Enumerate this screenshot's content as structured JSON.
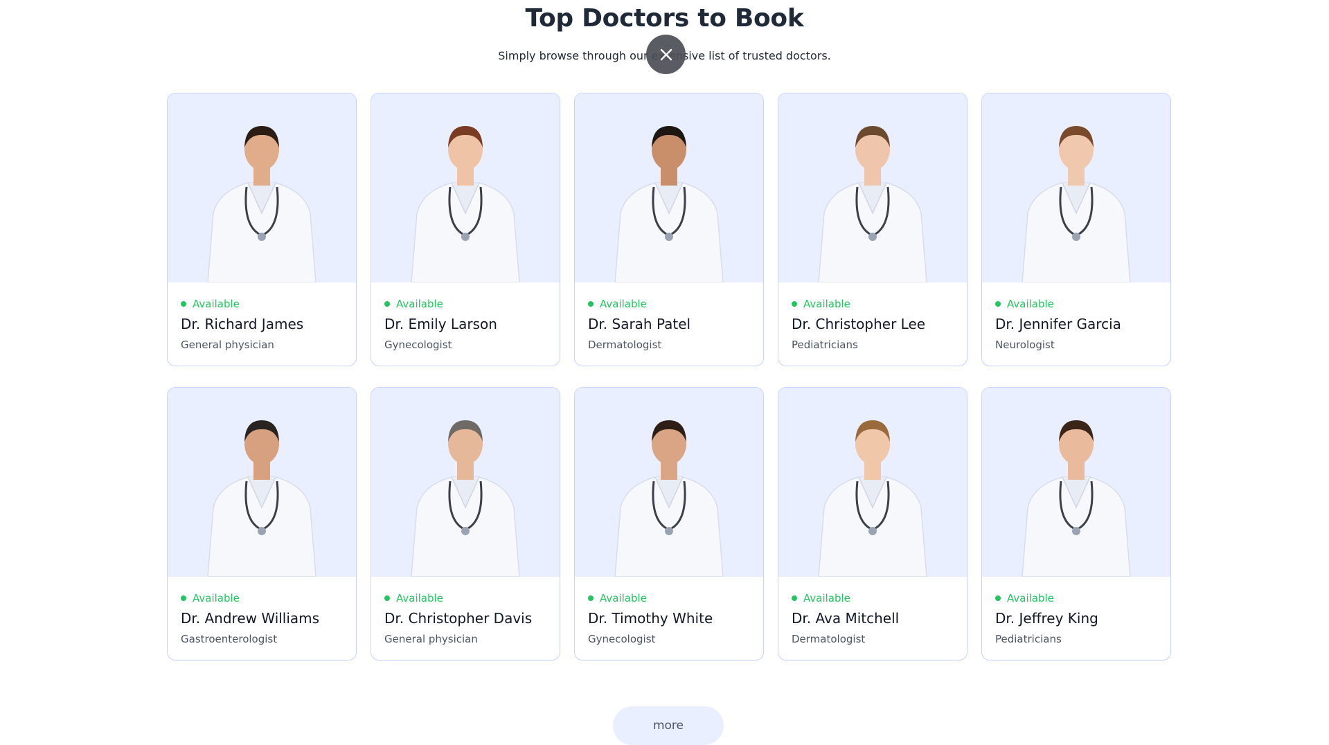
{
  "header": {
    "title": "Top Doctors to Book",
    "subtitle": "Simply browse through our extensive list of trusted doctors."
  },
  "overlay": {
    "close_icon": "close-icon"
  },
  "doctors": [
    {
      "status": "Available",
      "name": "Dr. Richard James",
      "specialty": "General physician",
      "skin": "#e0ac8a",
      "hair": "#2b1d14"
    },
    {
      "status": "Available",
      "name": "Dr. Emily Larson",
      "specialty": "Gynecologist",
      "skin": "#efc3a6",
      "hair": "#7a3b22"
    },
    {
      "status": "Available",
      "name": "Dr. Sarah Patel",
      "specialty": "Dermatologist",
      "skin": "#c98f6b",
      "hair": "#1e1712"
    },
    {
      "status": "Available",
      "name": "Dr. Christopher Lee",
      "specialty": "Pediatricians",
      "skin": "#efc6ac",
      "hair": "#6b4a2e"
    },
    {
      "status": "Available",
      "name": "Dr. Jennifer Garcia",
      "specialty": "Neurologist",
      "skin": "#f0c8ad",
      "hair": "#7b4a2a"
    },
    {
      "status": "Available",
      "name": "Dr. Andrew Williams",
      "specialty": "Gastroenterologist",
      "skin": "#d7a07e",
      "hair": "#2a2420"
    },
    {
      "status": "Available",
      "name": "Dr. Christopher Davis",
      "specialty": "General physician",
      "skin": "#e6b89a",
      "hair": "#6f6a66"
    },
    {
      "status": "Available",
      "name": "Dr. Timothy White",
      "specialty": "Gynecologist",
      "skin": "#d9a584",
      "hair": "#2e1e16"
    },
    {
      "status": "Available",
      "name": "Dr. Ava Mitchell",
      "specialty": "Dermatologist",
      "skin": "#f0c7a9",
      "hair": "#9a6a3c"
    },
    {
      "status": "Available",
      "name": "Dr. Jeffrey King",
      "specialty": "Pediatricians",
      "skin": "#e9bb9c",
      "hair": "#3b2418"
    }
  ],
  "more_label": "more",
  "colors": {
    "available": "#22c55e",
    "card_bg": "#eaefff",
    "card_border": "#c7d2fe"
  }
}
